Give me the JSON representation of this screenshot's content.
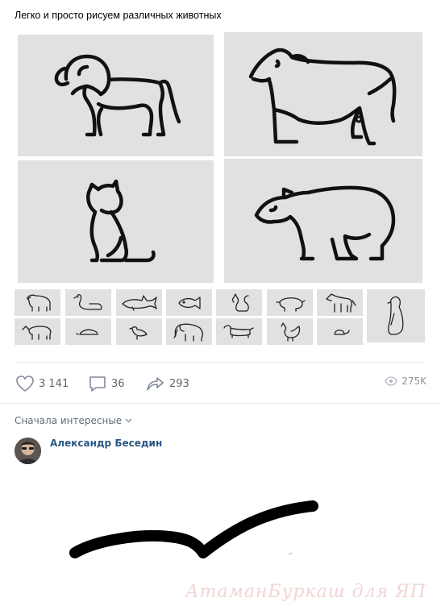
{
  "post": {
    "text": "Легко и просто рисуем различных животных"
  },
  "photos": {
    "large": [
      {
        "icon": "lion-outline"
      },
      {
        "icon": "cow-outline"
      },
      {
        "icon": "cat-outline"
      },
      {
        "icon": "bear-outline"
      }
    ],
    "thumbnails": [
      "gorilla-icon",
      "swan-icon",
      "shark-icon",
      "fish-icon",
      "squirrel-icon",
      "pig-icon",
      "horse-icon",
      "rhino-icon",
      "mole-icon",
      "bird-icon",
      "elephant-icon",
      "dachshund-icon",
      "rooster-icon",
      "mouse-icon"
    ],
    "extra_thumb": "penguin-icon"
  },
  "actions": {
    "likes": "3 141",
    "comments": "36",
    "shares": "293",
    "views": "275K"
  },
  "comments": {
    "sort_label": "Сначала интересные",
    "author": "Александр Беседин",
    "attachment": "drawn-line-sketch"
  },
  "watermark": "АтаманБуркаш для ЯП",
  "colors": {
    "photo_bg": "#e1e1e1",
    "link": "#2a5885",
    "muted": "#939393"
  }
}
